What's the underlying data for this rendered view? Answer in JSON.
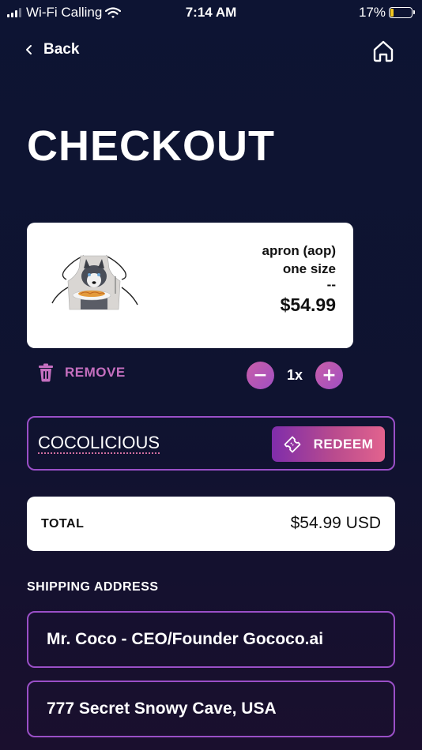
{
  "status_bar": {
    "carrier": "Wi-Fi Calling",
    "time": "7:14 AM",
    "battery": "17%",
    "battery_level": 0.17
  },
  "nav": {
    "back_label": "Back",
    "back_icon": "chevron-left-icon",
    "home_icon": "home-icon"
  },
  "title": "CHECKOUT",
  "cart": {
    "items": [
      {
        "name": "apron (aop)",
        "size": "one size",
        "variant": "--",
        "price": "$54.99",
        "quantity": "1x"
      }
    ],
    "remove_label": "REMOVE",
    "remove_icon": "trash-icon",
    "decrement_label": "−",
    "increment_label": "+"
  },
  "promo": {
    "code": "COCOLICIOUS",
    "redeem_label": "REDEEM",
    "redeem_icon": "ticket-icon"
  },
  "total": {
    "label": "TOTAL",
    "value": "$54.99 USD"
  },
  "shipping": {
    "label": "SHIPPING ADDRESS",
    "name": "Mr. Coco - CEO/Founder Gococo.ai",
    "address": "777 Secret Snowy Cave, USA"
  },
  "colors": {
    "background": "#0d1433",
    "accent_purple": "#9a4fc7",
    "accent_pink": "#c56fbf",
    "battery_yellow": "#f2c81f"
  }
}
